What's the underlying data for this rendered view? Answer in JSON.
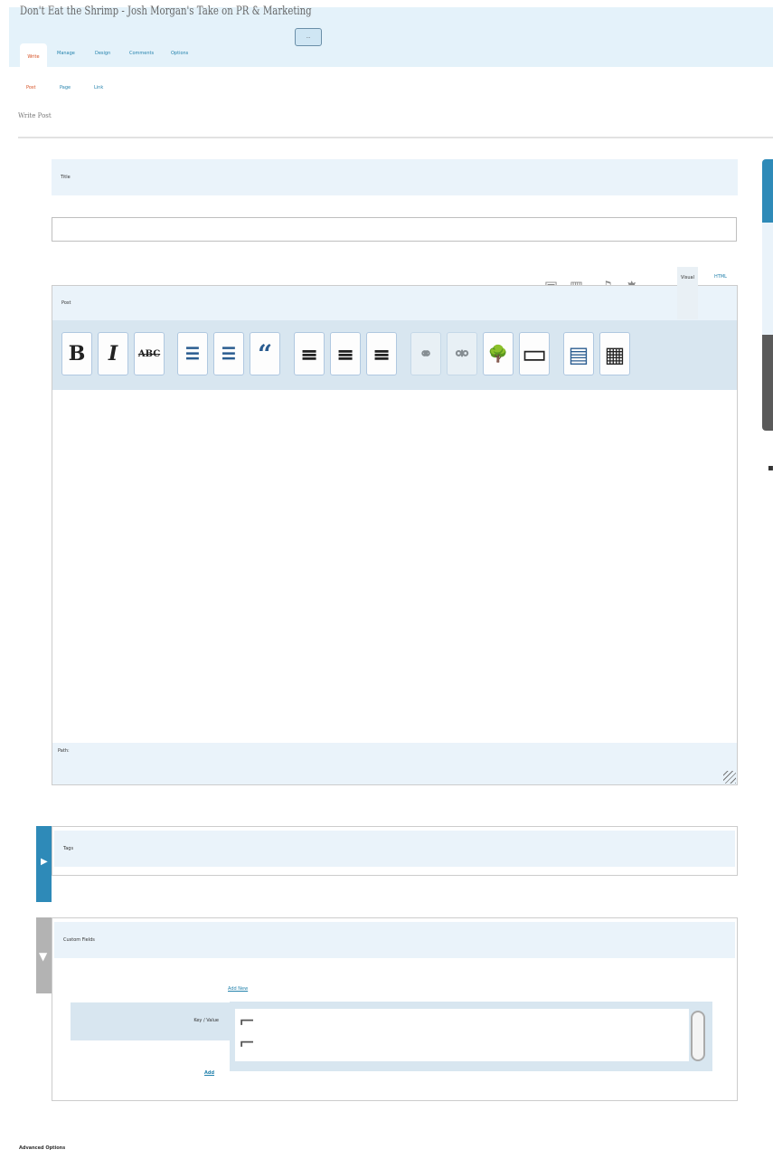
{
  "site": {
    "title": "Don't Eat the Shrimp - Josh Morgan's Take on PR & Marketing",
    "view_site": "..."
  },
  "nav": {
    "tabs": [
      "Write",
      "Manage",
      "Design",
      "Comments",
      "Options"
    ],
    "active": 0
  },
  "subnav": {
    "tabs": [
      "Post",
      "Page",
      "Link"
    ],
    "active": 0
  },
  "page": {
    "heading": "Write Post"
  },
  "title_box": {
    "label": "Title",
    "value": ""
  },
  "editor": {
    "label": "Post",
    "mode_visual": "Visual",
    "mode_html": "HTML",
    "path_label": "Path:",
    "toolbar": [
      {
        "name": "bold-button",
        "glyph": "B"
      },
      {
        "name": "italic-button",
        "glyph": "I"
      },
      {
        "name": "strikethrough-button",
        "glyph": "ABC"
      },
      {
        "name": "bulleted-list-button",
        "glyph": "☰"
      },
      {
        "name": "numbered-list-button",
        "glyph": "☰"
      },
      {
        "name": "blockquote-button",
        "glyph": "“"
      },
      {
        "name": "align-left-button",
        "glyph": "≡"
      },
      {
        "name": "align-center-button",
        "glyph": "≡"
      },
      {
        "name": "align-right-button",
        "glyph": "≡"
      },
      {
        "name": "insert-link-button",
        "glyph": "⚭"
      },
      {
        "name": "unlink-button",
        "glyph": "⚮"
      },
      {
        "name": "insert-image-button",
        "glyph": "🌳"
      },
      {
        "name": "insert-more-button",
        "glyph": "▭"
      },
      {
        "name": "spellcheck-button",
        "glyph": "▤"
      },
      {
        "name": "kitchen-sink-button",
        "glyph": "▦"
      }
    ]
  },
  "tags_box": {
    "label": "Tags"
  },
  "custom_fields": {
    "label": "Custom Fields",
    "add_new": "Add New",
    "field_label": "Key / Value",
    "submit": "Add"
  },
  "advanced": {
    "label": "Advanced Options"
  }
}
